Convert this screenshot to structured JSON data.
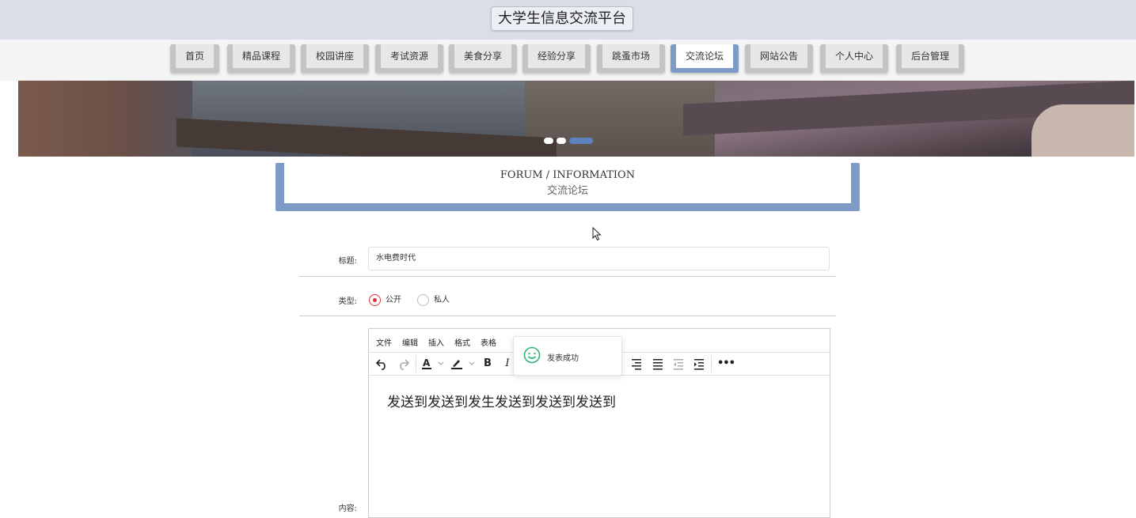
{
  "header": {
    "title": "大学生信息交流平台"
  },
  "nav": {
    "items": [
      {
        "label": "首页"
      },
      {
        "label": "精品课程"
      },
      {
        "label": "校园讲座"
      },
      {
        "label": "考试资源"
      },
      {
        "label": "美食分享"
      },
      {
        "label": "经验分享"
      },
      {
        "label": "跳蚤市场"
      },
      {
        "label": "交流论坛",
        "active": true
      },
      {
        "label": "网站公告"
      },
      {
        "label": "个人中心"
      },
      {
        "label": "后台管理"
      }
    ]
  },
  "banner": {
    "slides": 3,
    "active_slide": 3
  },
  "section": {
    "title_en": "FORUM / INFORMATION",
    "title_cn": "交流论坛"
  },
  "form": {
    "title_label": "标题:",
    "title_value": "水电费时代",
    "type_label": "类型:",
    "type_options": [
      {
        "label": "公开",
        "checked": true
      },
      {
        "label": "私人",
        "checked": false
      }
    ],
    "content_label": "内容:"
  },
  "editor": {
    "menu": [
      "文件",
      "编辑",
      "插入",
      "格式",
      "表格"
    ],
    "toolbar": [
      "undo-icon",
      "redo-icon",
      "text-color-icon",
      "highlight-color-icon",
      "bold-icon",
      "italic-icon",
      "align-right-icon",
      "align-justify-icon",
      "outdent-icon",
      "indent-icon",
      "more-icon"
    ],
    "content_text": "发送到发送到发生发送到发送到发送到"
  },
  "toast": {
    "message": "发表成功",
    "color": "#2bb673"
  },
  "colors": {
    "accent": "#7e9bc7",
    "radio": "#d9333f",
    "dot_active": "#5e82bd"
  }
}
